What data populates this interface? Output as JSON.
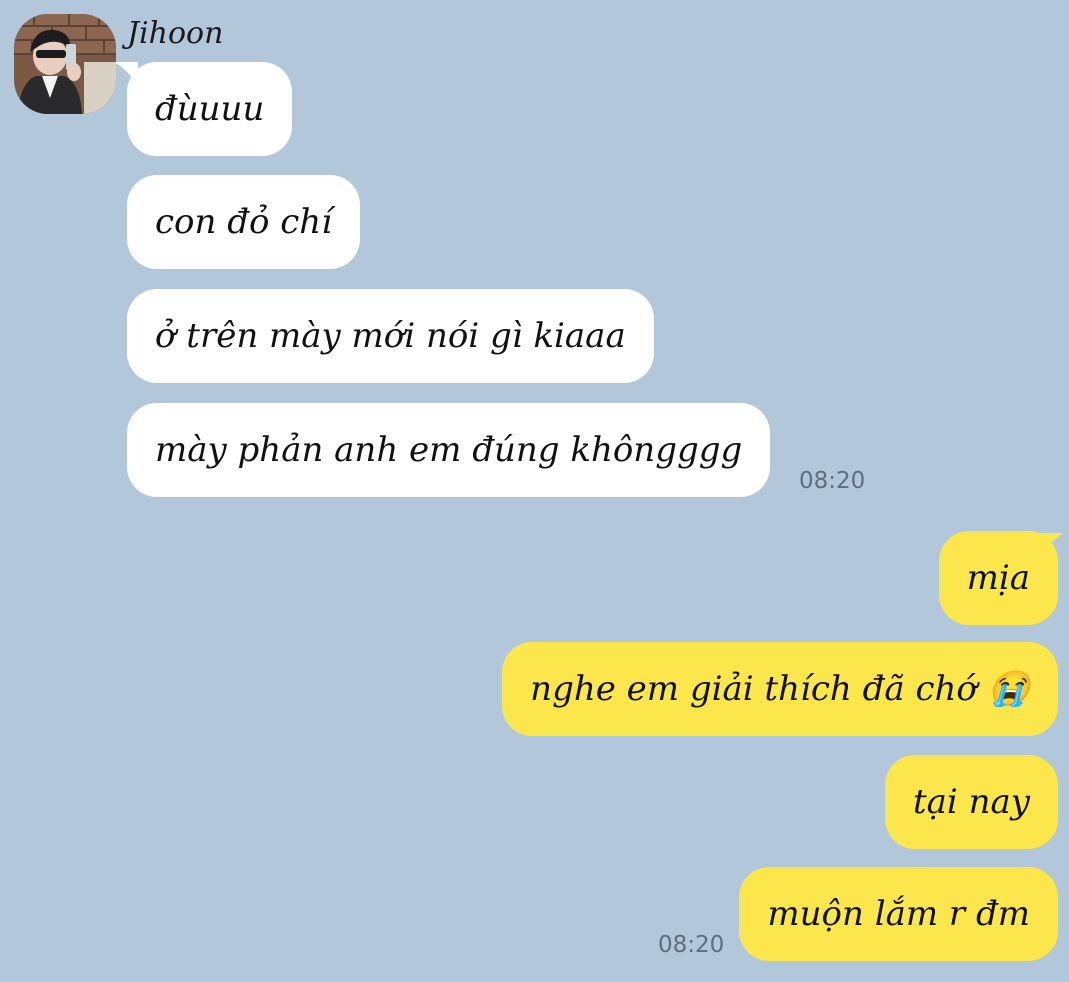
{
  "colors": {
    "background": "#b2c7da",
    "incoming_bubble": "#ffffff",
    "outgoing_bubble": "#fbe74b",
    "timestamp": "#5f6e7f"
  },
  "sender": {
    "name": "Jihoon",
    "avatar": "profile-photo"
  },
  "incoming": {
    "messages": [
      "đùuuu",
      "con đỏ chí",
      "ở trên mày mới nói gì kiaaa",
      "mày phản anh em đúng khôngggg"
    ],
    "time": "08:20"
  },
  "outgoing": {
    "messages": [
      "mịa",
      "nghe em giải thích đã chớ 😭",
      "tại nay",
      "muộn lắm r đm"
    ],
    "time": "08:20"
  }
}
